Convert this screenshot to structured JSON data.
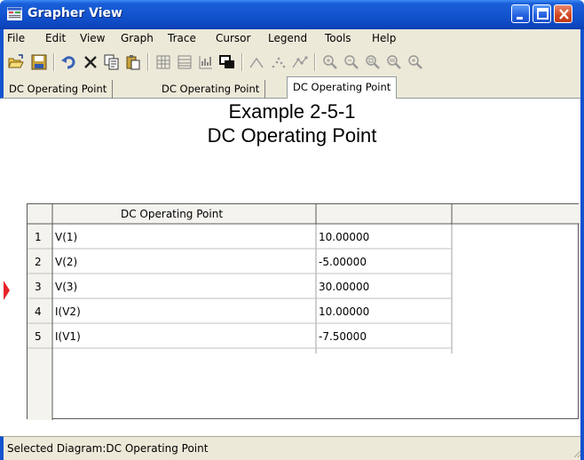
{
  "window": {
    "title": "Grapher View",
    "controls": {
      "minimize": "minimize-icon",
      "maximize": "maximize-icon",
      "close": "close-icon"
    }
  },
  "menu": [
    "File",
    "Edit",
    "View",
    "Graph",
    "Trace",
    "Cursor",
    "Legend",
    "Tools",
    "Help"
  ],
  "toolbar": {
    "icons": [
      "open-folder-icon",
      "save-icon",
      "undo-icon",
      "delete-icon",
      "copy-icon",
      "paste-icon",
      "grid-icon",
      "list-icon",
      "chart-icon",
      "overlay-icon",
      "line-plot-icon",
      "scatter-icon",
      "line-marker-icon",
      "zoom-icon",
      "zoom-out-icon",
      "zoom-selection-icon",
      "zoom-fit-icon",
      "zoom-in-icon"
    ]
  },
  "tabs": [
    {
      "label": "DC Operating Point",
      "active": false
    },
    {
      "label": "DC Operating Point",
      "active": false
    },
    {
      "label": "DC Operating Point",
      "active": true
    }
  ],
  "content": {
    "title": "Example 2-5-1",
    "subtitle": "DC Operating Point"
  },
  "table": {
    "columns": [
      "DC Operating Point",
      ""
    ],
    "rows": [
      {
        "num": "1",
        "name": "V(1)",
        "value": "10.00000"
      },
      {
        "num": "2",
        "name": "V(2)",
        "value": "-5.00000"
      },
      {
        "num": "3",
        "name": "V(3)",
        "value": "30.00000"
      },
      {
        "num": "4",
        "name": "I(V2)",
        "value": "10.00000"
      },
      {
        "num": "5",
        "name": "I(V1)",
        "value": "-7.50000"
      }
    ],
    "selected_row": 3
  },
  "status": {
    "text": "Selected Diagram:DC Operating Point"
  },
  "colors": {
    "title_bar": "#1353cf",
    "chrome": "#ece9d8",
    "close_button": "#d2471f",
    "row_marker": "#e8242a"
  }
}
